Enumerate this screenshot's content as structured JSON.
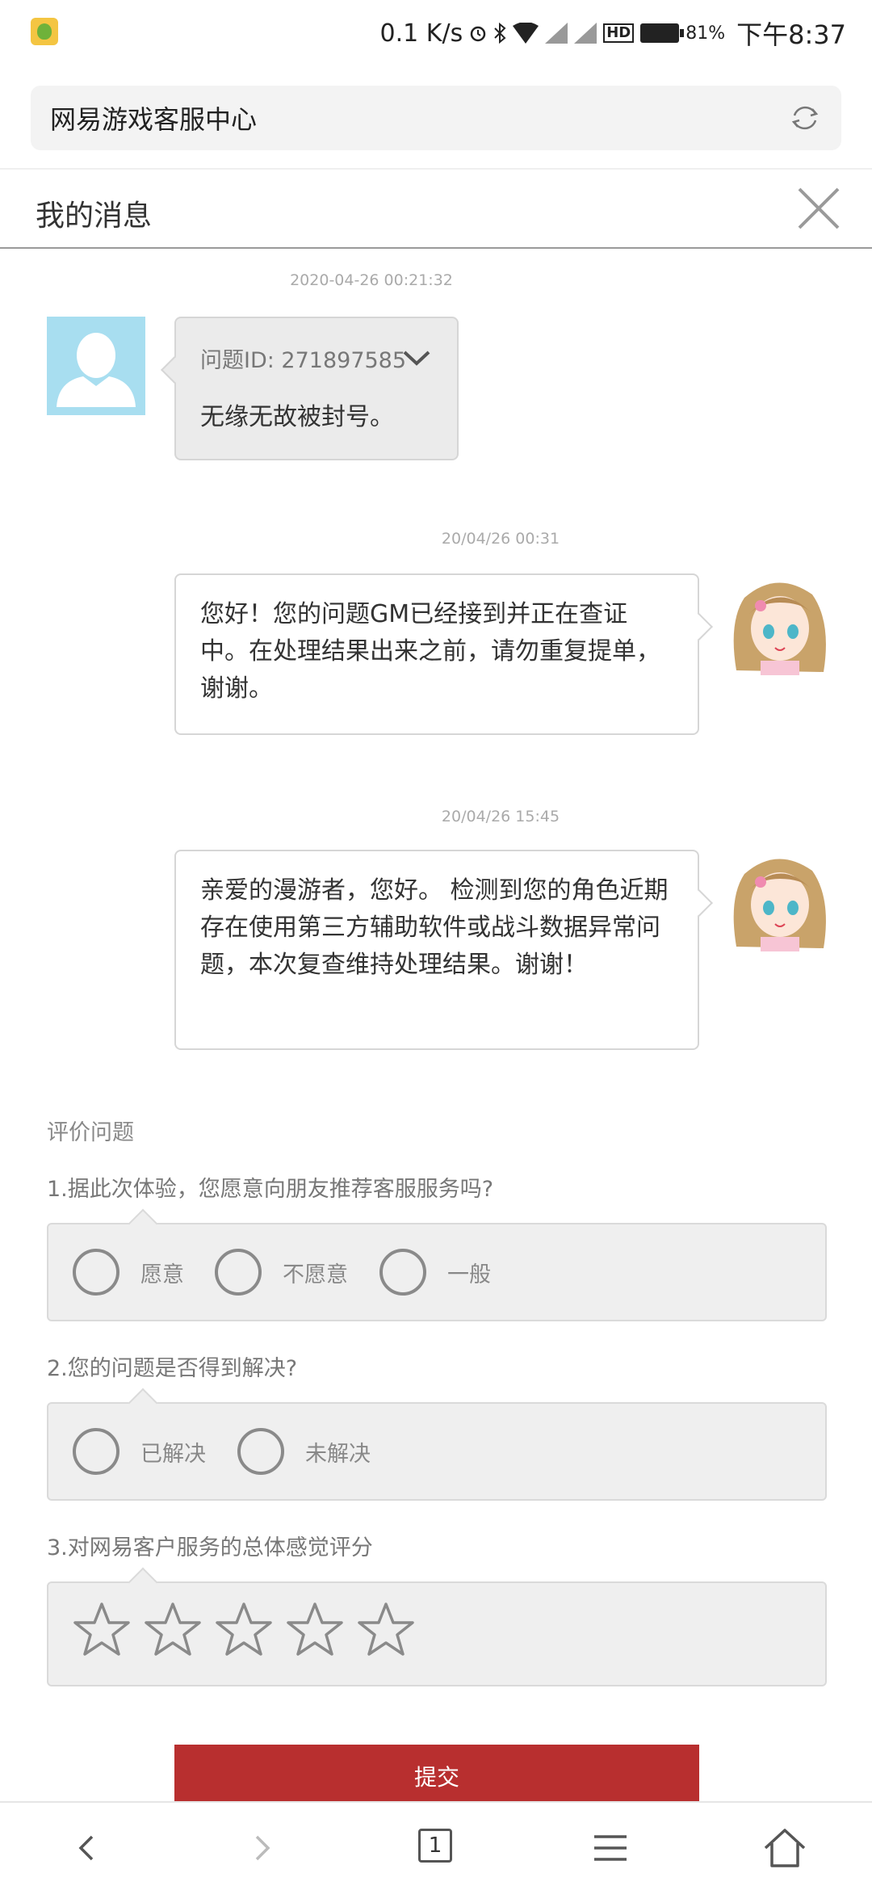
{
  "status_bar": {
    "network_speed": "0.1 K/s",
    "battery_percent": "81%",
    "time": "下午8:37",
    "hd_badge": "HD"
  },
  "browser": {
    "page_title": "网易游戏客服中心"
  },
  "header": {
    "title": "我的消息"
  },
  "messages": [
    {
      "timestamp": "2020-04-26 00:21:32",
      "issue_id": "问题ID: 271897585",
      "text": "无缘无故被封号。"
    },
    {
      "timestamp": "20/04/26 00:31",
      "text": "您好！您的问题GM已经接到并正在查证中。在处理结果出来之前，请勿重复提单，谢谢。"
    },
    {
      "timestamp": "20/04/26 15:45",
      "text": "亲爱的漫游者，您好。 检测到您的角色近期存在使用第三方辅助软件或战斗数据异常问题，本次复查维持处理结果。谢谢！"
    }
  ],
  "evaluation": {
    "section_label": "评价问题",
    "q1": {
      "question": "1.据此次体验，您愿意向朋友推荐客服服务吗?",
      "options": [
        "愿意",
        "不愿意",
        "一般"
      ]
    },
    "q2": {
      "question": "2.您的问题是否得到解决?",
      "options": [
        "已解决",
        "未解决"
      ]
    },
    "q3": {
      "question": "3.对网易客户服务的总体感觉评分",
      "rating": 0,
      "max_rating": 5
    },
    "submit_label": "提交"
  },
  "bottom_nav": {
    "tab_count": "1"
  },
  "colors": {
    "submit_red": "#b82f2f",
    "user_avatar_bg": "#a8def0"
  }
}
